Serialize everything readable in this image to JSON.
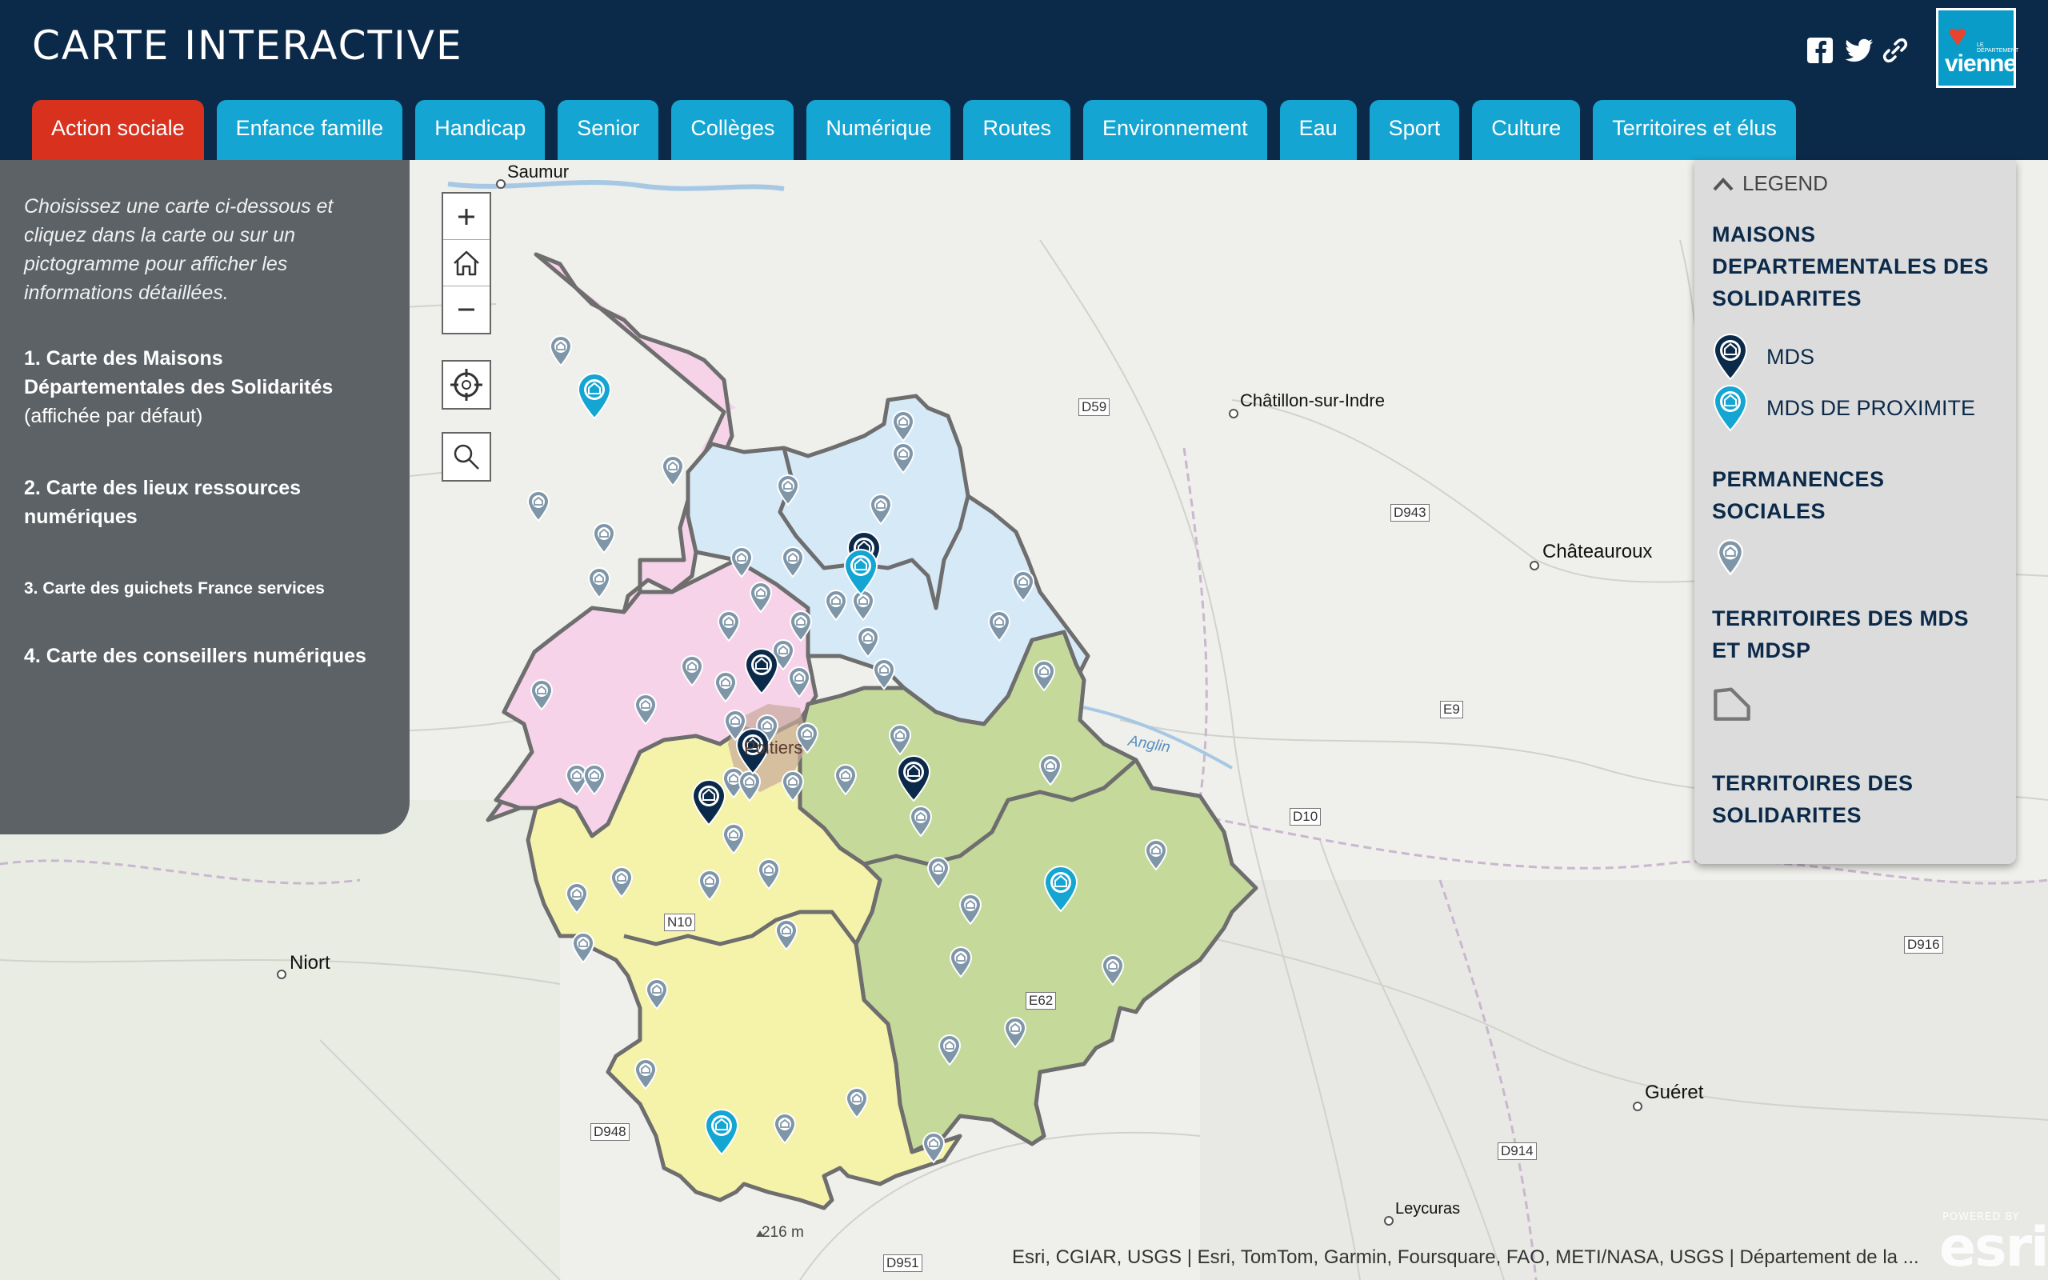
{
  "header": {
    "title": "CARTE INTERACTIVE",
    "logo_text": "vienne",
    "logo_small": "LE DÉPARTEMENT"
  },
  "tabs": [
    {
      "label": "Action sociale",
      "active": true
    },
    {
      "label": "Enfance famille"
    },
    {
      "label": "Handicap"
    },
    {
      "label": "Senior"
    },
    {
      "label": "Collèges"
    },
    {
      "label": "Numérique"
    },
    {
      "label": "Routes"
    },
    {
      "label": "Environnement"
    },
    {
      "label": "Eau"
    },
    {
      "label": "Sport"
    },
    {
      "label": "Culture"
    },
    {
      "label": "Territoires et élus"
    }
  ],
  "panel": {
    "intro": "Choisissez une carte ci-dessous et cliquez dans la carte ou sur un pictogramme pour afficher les informations détaillées.",
    "item1_main": "1. Carte des Maisons Départementales des Solidarités",
    "item1_sub": "(affichée par défaut)",
    "item2": "2. Carte des lieux ressources numériques",
    "item3": "3. Carte des guichets France services",
    "item4": "4. Carte des conseillers numériques"
  },
  "legend": {
    "header": "LEGEND",
    "section1": "MAISONS DEPARTEMENTALES DES SOLIDARITES",
    "mds": "MDS",
    "mdsp": "MDS DE PROXIMITE",
    "section2": "PERMANENCES SOCIALES",
    "section3": "TERRITOIRES DES MDS ET MDSP",
    "section4": "TERRITOIRES DES SOLIDARITES"
  },
  "places": {
    "saumur": "Saumur",
    "chatillon": "Châtillon-sur-Indre",
    "chateauroux": "Châteauroux",
    "niort": "Niort",
    "gueret": "Guéret",
    "leycuras": "Leycuras",
    "poitiers": "Poitiers",
    "anglin": "Anglin",
    "elev": "216 m"
  },
  "roads": {
    "d59": "D59",
    "d943": "D943",
    "e9": "E9",
    "d10": "D10",
    "d916": "D916",
    "n10": "N10",
    "e62": "E62",
    "d948": "D948",
    "d914": "D914",
    "d951": "D951"
  },
  "attribution": "Esri, CGIAR, USGS | Esri, TomTom, Garmin, Foursquare, FAO, METI/NASA, USGS | Département de la ...",
  "esri": {
    "brand": "esri",
    "powered": "POWERED BY"
  },
  "colors": {
    "header_bg": "#0b2a4a",
    "tab_active": "#d8321f",
    "tab": "#14a5d2",
    "zone_pink": "#f7d3ea",
    "zone_blue": "#d6e9f7",
    "zone_yellow": "#f5f1a8",
    "zone_green": "#c4d99a",
    "mds_marker": "#0b2a4a",
    "mdsp_marker": "#14a5d2"
  },
  "map_controls": [
    "zoom-in",
    "home",
    "zoom-out",
    "locate",
    "search"
  ]
}
